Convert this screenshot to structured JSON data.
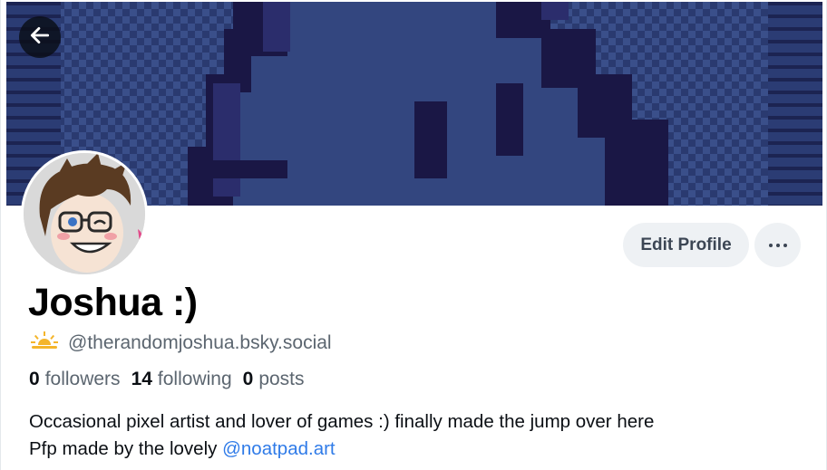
{
  "profile": {
    "display_name": "Joshua :)",
    "handle": "@therandomjoshua.bsky.social",
    "handle_badge_icon": "sun-horizon-icon",
    "stats": {
      "followers_count": "0",
      "followers_label": "followers",
      "following_count": "14",
      "following_label": "following",
      "posts_count": "0",
      "posts_label": "posts"
    },
    "bio": {
      "line1": "Occasional pixel artist and lover of games :) finally made the jump over here",
      "line2_prefix": "Pfp made by the lovely ",
      "line2_mention": "@noatpad.art"
    }
  },
  "actions": {
    "edit_profile_label": "Edit Profile",
    "more_icon": "ellipsis-icon",
    "back_icon": "arrow-left-icon"
  },
  "colors": {
    "banner_dark": "#1a1745",
    "banner_mid": "#2d3e79",
    "banner_light": "#3e5494",
    "link": "#2f7be8",
    "muted_text": "#5c6670",
    "button_bg": "#eef1f4"
  }
}
